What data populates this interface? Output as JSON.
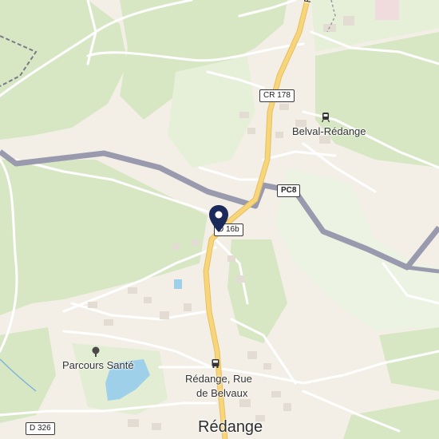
{
  "map": {
    "place_labels": {
      "belval": "Belval-Rédange",
      "parcours": "Parcours Santé",
      "stop_line1": "Rédange, Rue",
      "stop_line2": "de Belvaux",
      "town": "Rédange",
      "road_top": "Ro"
    },
    "road_shields": {
      "cr178": "CR 178",
      "pc8": "PC8",
      "d16b": "D 16b",
      "d326": "D 326"
    },
    "icons": [
      "location-pin-icon",
      "tree-icon",
      "bus-stop-icon",
      "train-station-icon"
    ],
    "colors": {
      "land": "#f3efe6",
      "forest": "#d9e8c8",
      "field": "#e6efd8",
      "water": "#9fd0ea",
      "main_road": "#f7d57a",
      "border": "#9a9aae",
      "pin": "#1a2a5a"
    }
  }
}
